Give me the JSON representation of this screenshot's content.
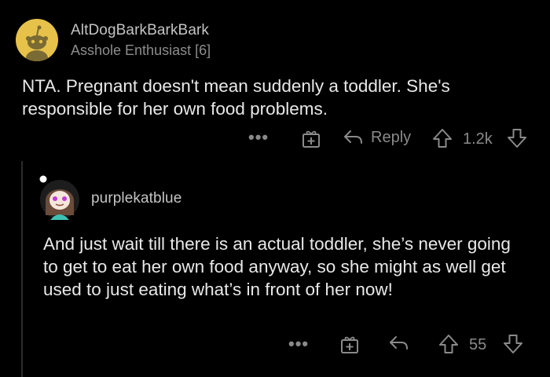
{
  "parent_comment": {
    "username": "AltDogBarkBarkBark",
    "flair": "Asshole Enthusiast [6]",
    "body": "NTA. Pregnant doesn't mean suddenly a toddler. She's responsible for her own food problems.",
    "actions": {
      "more": "•••",
      "reply_label": "Reply",
      "score": "1.2k"
    },
    "avatar_icon": "reddit-snoo-avatar",
    "avatar_color": "#e8c94a"
  },
  "reply_comment": {
    "username": "purplekatblue",
    "body": "And just wait till there is an actual toddler, she’s never going to get to eat her own food anyway, so she might as well get used to just eating what’s in front of her now!",
    "actions": {
      "more": "•••",
      "score": "55"
    },
    "avatar_icon": "custom-snoo-avatar"
  },
  "icons": {
    "award": "gift-award-icon",
    "reply": "reply-arrow-icon",
    "upvote": "upvote-arrow-icon",
    "downvote": "downvote-arrow-icon"
  }
}
